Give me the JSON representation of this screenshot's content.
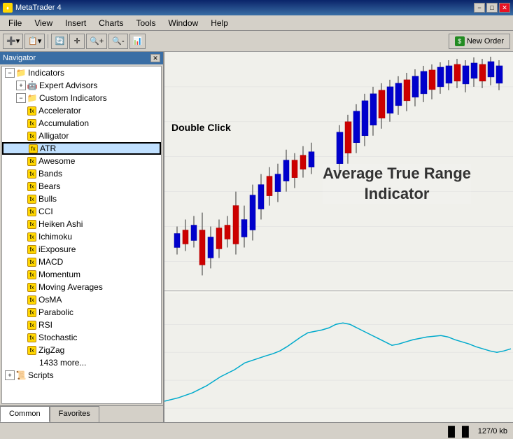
{
  "titleBar": {
    "title": "MetaTrader 4",
    "minLabel": "−",
    "maxLabel": "□",
    "closeLabel": "✕"
  },
  "menuBar": {
    "items": [
      "File",
      "View",
      "Insert",
      "Charts",
      "Tools",
      "Window",
      "Help"
    ]
  },
  "toolbar": {
    "newOrderLabel": "New Order",
    "buttons": [
      "➕",
      "📋",
      "🔄",
      "✛",
      "📤",
      "📥",
      "📊"
    ]
  },
  "navigator": {
    "title": "Navigator",
    "closeLabel": "✕",
    "tree": {
      "indicators": "Indicators",
      "expertAdvisors": "Expert Advisors",
      "customIndicators": "Custom Indicators",
      "items": [
        "Accelerator",
        "Accumulation",
        "Alligator",
        "ATR",
        "Awesome",
        "Bands",
        "Bears",
        "Bulls",
        "CCI",
        "Heiken Ashi",
        "Ichimoku",
        "iExposure",
        "MACD",
        "Momentum",
        "Moving Averages",
        "OsMA",
        "Parabolic",
        "RSI",
        "Stochastic",
        "ZigZag",
        "1433 more..."
      ],
      "scripts": "Scripts"
    }
  },
  "chart": {
    "doubleClickLabel": "Double Click",
    "atrLabelLine1": "Average True Range",
    "atrLabelLine2": "Indicator"
  },
  "tabs": {
    "common": "Common",
    "favorites": "Favorites"
  },
  "statusBar": {
    "info": "127/0 kb"
  }
}
